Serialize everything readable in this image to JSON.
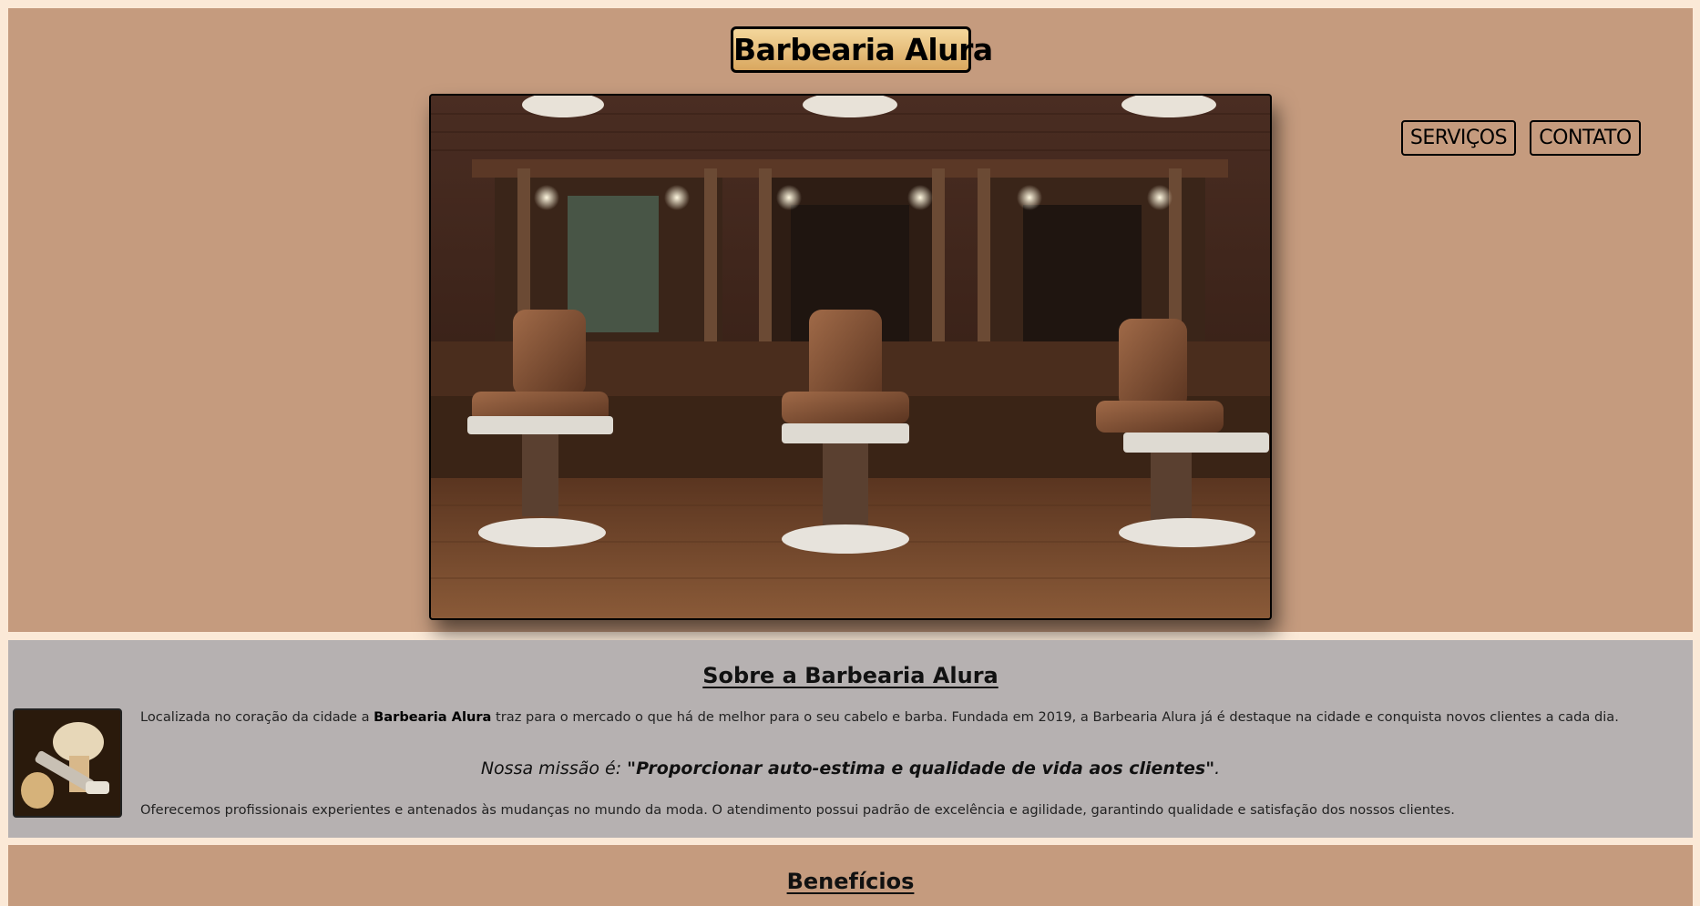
{
  "header": {
    "logo": "Barbearia Alura",
    "nav": [
      {
        "label": "SERVIÇOS"
      },
      {
        "label": "CONTATO"
      }
    ],
    "hero_image": "barbershop-interior-photo"
  },
  "about": {
    "title": "Sobre a Barbearia Alura",
    "image": "shaving-brush-razor-photo",
    "p1_before": "Localizada no coração da cidade a ",
    "p1_bold": "Barbearia Alura",
    "p1_after": " traz para o mercado o que há de melhor para o seu cabelo e barba. Fundada em 2019, a Barbearia Alura já é destaque na cidade e conquista novos clientes a cada dia.",
    "mission_prefix": "Nossa missão é: ",
    "mission_quote": "\"Proporcionar auto-estima e qualidade de vida aos clientes\"",
    "mission_suffix": ".",
    "p2": "Oferecemos profissionais experientes e antenados às mudanças no mundo da moda. O atendimento possui padrão de excelência e agilidade, garantindo qualidade e satisfação dos nossos clientes."
  },
  "benefits": {
    "title": "Benefícios"
  },
  "colors": {
    "header_bg": "#c59b7e",
    "about_bg": "#b6b1b1",
    "page_bg": "#fbe9d7",
    "logo_gold": "#e0b46c"
  }
}
